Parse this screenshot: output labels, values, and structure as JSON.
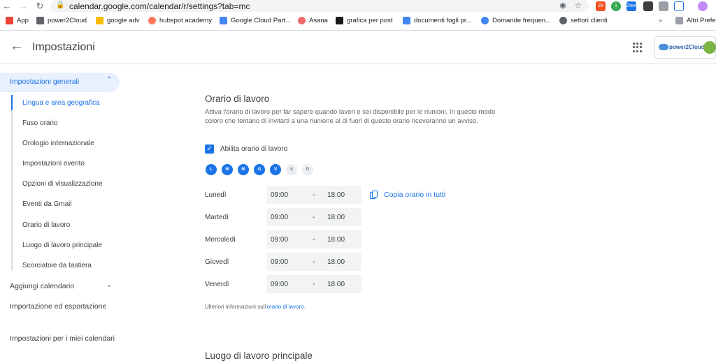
{
  "browser": {
    "url": "calendar.google.com/calendar/r/settings?tab=mc",
    "extension_badges": [
      "28",
      "1",
      "Zoom"
    ],
    "bookmarks": [
      {
        "label": "App",
        "color": "#ea4335"
      },
      {
        "label": "power2Cloud",
        "color": "#5f6368"
      },
      {
        "label": "google adv",
        "color": "#fbbc04"
      },
      {
        "label": "hubspot academy",
        "color": "#ff7a59"
      },
      {
        "label": "Google Cloud Part...",
        "color": "#4285f4"
      },
      {
        "label": "Asana",
        "color": "#f06a6a"
      },
      {
        "label": "grafica per post",
        "color": "#1a1a1a"
      },
      {
        "label": "documenti fogli pr...",
        "color": "#4285f4"
      },
      {
        "label": "Domande frequen...",
        "color": "#4285f4"
      },
      {
        "label": "settori clienti",
        "color": "#5f6368"
      }
    ],
    "other_bookmarks": "Altri Prefer"
  },
  "header": {
    "title": "Impostazioni",
    "logo_text": "power2Cloud"
  },
  "sidebar": {
    "active_section": "Impostazioni generali",
    "sub_items": [
      "Lingua e area geografica",
      "Fuso orario",
      "Orologio internazionale",
      "Impostazioni evento",
      "Opzioni di visualizzazione",
      "Eventi da Gmail",
      "Orario di lavoro",
      "Luogo di lavoro principale",
      "Scorciatoie da tastiera"
    ],
    "add_calendar": "Aggiungi calendario",
    "import_export": "Importazione ed esportazione",
    "my_calendars": "Impostazioni per i miei calendari"
  },
  "main": {
    "section_title": "Orario di lavoro",
    "description": "Attiva l'orario di lavoro per far sapere quando lavori e sei disponibile per le riunioni. In questo modo coloro che tentano di invitarti a una riunione al di fuori di questo orario riceveranno un avviso.",
    "enable_label": "Abilita orario di lavoro",
    "days": [
      {
        "letter": "L",
        "active": true
      },
      {
        "letter": "M",
        "active": true
      },
      {
        "letter": "M",
        "active": true
      },
      {
        "letter": "G",
        "active": true
      },
      {
        "letter": "V",
        "active": true
      },
      {
        "letter": "S",
        "active": false
      },
      {
        "letter": "D",
        "active": false
      }
    ],
    "schedule": [
      {
        "day": "Lunedì",
        "start": "09:00",
        "end": "18:00"
      },
      {
        "day": "Martedì",
        "start": "09:00",
        "end": "18:00"
      },
      {
        "day": "Mercoledì",
        "start": "09:00",
        "end": "18:00"
      },
      {
        "day": "Giovedì",
        "start": "09:00",
        "end": "18:00"
      },
      {
        "day": "Venerdì",
        "start": "09:00",
        "end": "18:00"
      }
    ],
    "separator": "-",
    "copy_label": "Copia orario in tutti",
    "more_info_prefix": "Ulteriori informazioni sull'",
    "more_info_link": "orario di lavoro",
    "more_info_suffix": ".",
    "next_section_title": "Luogo di lavoro principale"
  }
}
